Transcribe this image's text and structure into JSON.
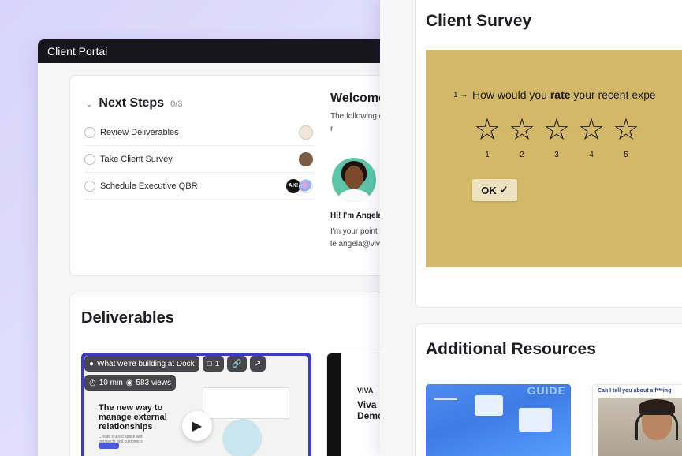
{
  "portal": {
    "window_title": "Client Portal",
    "next_steps": {
      "title": "Next Steps",
      "count": "0/3",
      "items": [
        {
          "label": "Review Deliverables"
        },
        {
          "label": "Take Client Survey"
        },
        {
          "label": "Schedule Executive QBR"
        }
      ],
      "ak_badge": "AK!"
    },
    "welcome": {
      "title": "Welcome",
      "text": "The following dashboards, r",
      "greeting": "Hi! I'm Angela",
      "bio": "I'm your point something, le angela@viva.c"
    },
    "deliverables": {
      "title": "Deliverables",
      "video": {
        "title": "What we're building at Dock",
        "comments": "1",
        "duration": "10 min",
        "views": "583 views",
        "headline": "The new way to manage external relationships",
        "sub": "Create shared space with prospects and customers"
      },
      "doc": {
        "logo": "VIVA",
        "title": "Viva Demo"
      }
    }
  },
  "survey": {
    "title": "Client Survey",
    "question_number": "1 →",
    "question_prefix": "How would you ",
    "question_bold": "rate",
    "question_suffix": " your recent expe",
    "ratings": [
      "1",
      "2",
      "3",
      "4",
      "5"
    ],
    "ok_label": "OK",
    "box_color": "#d4b86a"
  },
  "resources": {
    "title": "Additional Resources",
    "thumb1_label": "GUIDE",
    "thumb2_caption": "Can I tell you about a f***ing"
  },
  "colors": {
    "accent": "#3d3cbf",
    "background": "#dcd8fb",
    "titlebar": "#16161c"
  }
}
